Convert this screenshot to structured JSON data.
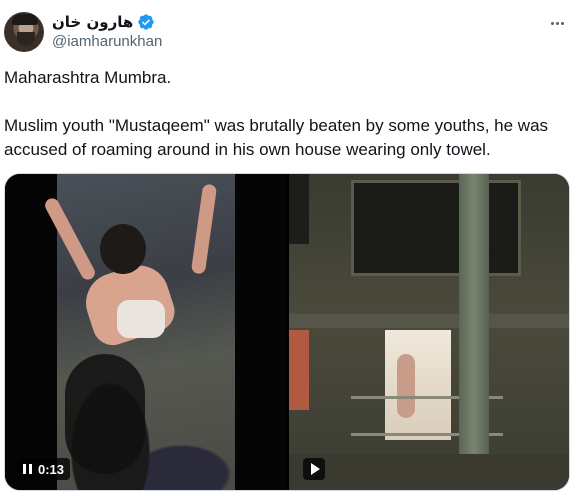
{
  "author": {
    "display_name": "هارون خان",
    "handle": "@iamharunkhan",
    "verified": true,
    "verified_icon": "verified-badge-icon",
    "verified_color": "#1d9bf0"
  },
  "tweet": {
    "line1": "Maharashtra Mumbra.",
    "line2": "Muslim youth \"Mustaqeem\" was brutally beaten by some youths, he was accused of roaming around in his own house wearing only towel."
  },
  "media": {
    "video1": {
      "state": "playing",
      "control_icon": "pause-icon",
      "duration": "0:13"
    },
    "video2": {
      "state": "paused",
      "control_icon": "play-icon"
    }
  },
  "menu": {
    "icon": "more-options-icon"
  }
}
